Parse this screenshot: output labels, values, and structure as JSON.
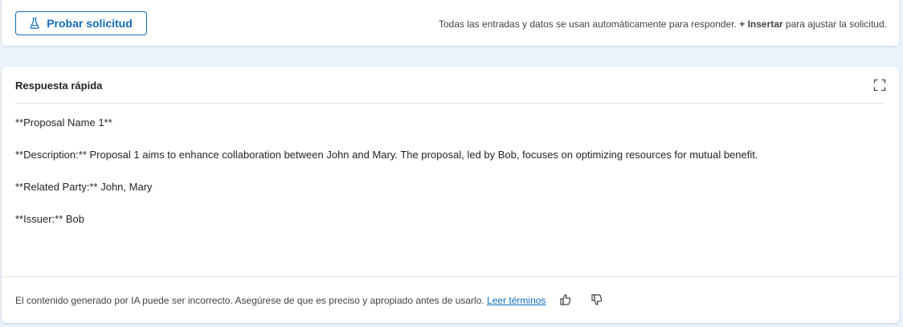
{
  "toolbar": {
    "test_button_label": "Probar solicitud",
    "hint_prefix": "Todas las entradas y datos se usan automáticamente para responder. ",
    "hint_plus": "+ ",
    "hint_insert": "Insertar",
    "hint_suffix": " para ajustar la solicitud."
  },
  "response": {
    "title": "Respuesta rápida",
    "lines": [
      "**Proposal Name 1**",
      "**Description:** Proposal 1 aims to enhance collaboration between John and Mary. The proposal, led by Bob, focuses on optimizing resources for mutual benefit.",
      "**Related Party:** John, Mary",
      "**Issuer:** Bob"
    ]
  },
  "footer": {
    "disclaimer": "El contenido generado por IA puede ser incorrecto. Asegúrese de que es preciso y apropiado antes de usarlo. ",
    "terms_link": "Leer términos"
  },
  "icons": {
    "test": "flask-icon",
    "expand": "expand-icon",
    "like": "thumbs-up-icon",
    "dislike": "thumbs-down-icon"
  },
  "colors": {
    "accent": "#0f6cbd",
    "background": "#eaf3fc",
    "card": "#ffffff"
  }
}
